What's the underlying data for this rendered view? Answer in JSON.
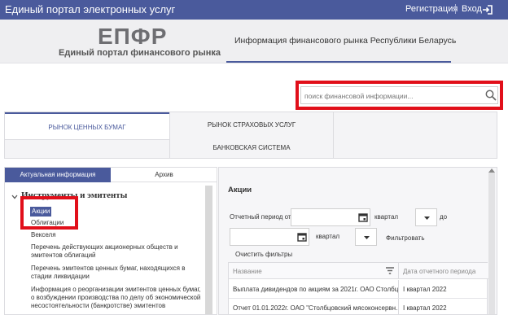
{
  "topbar": {
    "site_title": "Единый портал электронных услуг",
    "register_label": "Регистрация",
    "login_label": "Вход",
    "login_icon": "login-arrow-icon"
  },
  "header": {
    "logo_big": "ЕПФР",
    "logo_sub": "Единый портал финансового рынка",
    "nav_link": "Информация финансового рынка Республики Беларусь"
  },
  "search": {
    "placeholder": "поиск финансовой информации...",
    "icon": "search-icon"
  },
  "market_tabs": {
    "securities": "РЫНОК ЦЕННЫХ БУМАГ",
    "insurance": "РЫНОК СТРАХОВЫХ УСЛУГ",
    "banking": "БАНКОВСКАЯ СИСТЕМА"
  },
  "left": {
    "tab_current": "Актуальная информация",
    "tab_archive": "Архив",
    "tree_heading": "Инструменты и эмитенты",
    "items": [
      "Акции",
      "Облигации",
      "Векселя",
      "Перечень действующих акционерных обществ и эмитентов облигаций",
      "Перечень эмитентов ценных бумаг, находящихся в стадии ликвидации",
      "Информация о реорганизации эмитентов ценных бумаг, о возбуждении производства по делу об экономической несостоятельности (банкротстве) эмитентов"
    ]
  },
  "right": {
    "title": "Акции",
    "period_from_label": "Отчетный период от",
    "quarter_label_1": "квартал",
    "to_label": "до",
    "quarter_label_2": "квартал",
    "filter_label": "Фильтровать",
    "clear_label": "Очистить фильтры",
    "columns": [
      "Название",
      "Дата отчетного периода"
    ],
    "rows": [
      [
        "Выплата дивидендов по акциям за 2021г. ОАО Столбц...",
        "I квартал 2022"
      ],
      [
        "Отчет 01.01.2022г. ОАО \"Столбцовский мясоконсервн...",
        "I квартал 2022"
      ]
    ]
  },
  "colors": {
    "brand": "#4a5a9c",
    "highlight": "#e10f1a"
  }
}
